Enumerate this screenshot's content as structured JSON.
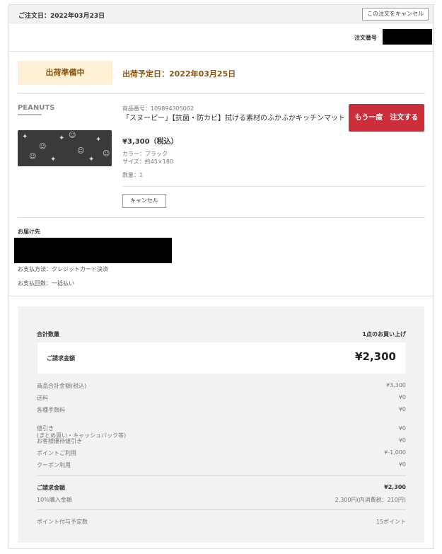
{
  "header": {
    "order_date": "ご注文日：2022年03月23日",
    "cancel_order_label": "この注文をキャンセル"
  },
  "order_number": {
    "label": "注文番号"
  },
  "status": {
    "badge": "出荷準備中",
    "ship_date": "出荷予定日：2022年03月25日"
  },
  "product": {
    "code": "商品番号：109894305002",
    "name": "「スヌーピー」【抗菌・防カビ】拭ける素材のふかふかキッチンマット",
    "price": "¥3,300（税込）",
    "color": "カラー：ブラック",
    "size": "サイズ：約45×180",
    "quantity": "数量：1",
    "reorder_label": "もう一度　注文する",
    "cancel_label": "キャンセル",
    "brand_logo": "PEANUTS"
  },
  "delivery": {
    "label": "お届け先",
    "payment_method": "お支払方法：クレジットカード決済",
    "payment_count": "お支払回数：一括払い"
  },
  "summary": {
    "total_qty_label": "合計数量",
    "total_qty_value": "1点のお買い上げ",
    "bill_label": "ご請求金額",
    "bill_value": "¥2,300",
    "rows": [
      {
        "label": "商品合計金額(税込)",
        "value": "¥3,300"
      },
      {
        "label": "送料",
        "value": "¥0"
      },
      {
        "label": "各種手数料",
        "value": "¥0"
      },
      {
        "label": "値引き\n(まとめ買い・キャッシュバック等)",
        "value": "¥0"
      },
      {
        "label": "お客様優待値引き",
        "value": "¥0"
      },
      {
        "label": "ポイントご利用",
        "value": "¥-1,000"
      },
      {
        "label": "クーポン利用",
        "value": "¥0"
      }
    ],
    "bill_total_label": "ご請求金額",
    "bill_total_value": "¥2,300",
    "tax_label": "10%購入金額",
    "tax_value": "2,300円(内消費税：210円)",
    "points_label": "ポイント付与予定数",
    "points_value": "15ポイント"
  },
  "colors": {
    "accent_red": "#cc2e3a",
    "status_bg": "#fdf0d4",
    "status_text": "#8a5510"
  }
}
